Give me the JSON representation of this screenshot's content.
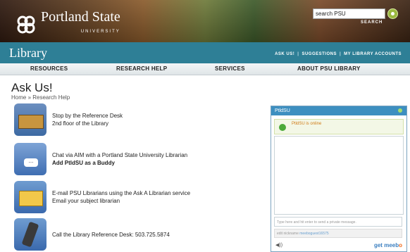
{
  "header": {
    "brand": "Portland State",
    "brand_sub": "UNIVERSITY",
    "search_value": "search PSU",
    "search_label": "SEARCH"
  },
  "library_bar": {
    "title": "Library",
    "links": [
      "ASK US!",
      "SUGGESTIONS",
      "MY LIBRARY ACCOUNTS"
    ]
  },
  "nav": {
    "items": [
      "RESOURCES",
      "RESEARCH HELP",
      "SERVICES",
      "ABOUT PSU LIBRARY"
    ]
  },
  "page": {
    "title": "Ask Us!",
    "breadcrumb": "Home » Research Help"
  },
  "contact_options": [
    {
      "line1": "Stop by the Reference Desk",
      "line2": "2nd floor of the Library",
      "icon": "reference-desk-icon"
    },
    {
      "line1": "Chat via AIM with a Portland State University Librarian",
      "line2": "Add PtldSU as a Buddy",
      "icon": "aim-chat-icon"
    },
    {
      "line1": "E-mail PSU Librarians using the Ask A Librarian service",
      "line2": "Email your subject librarian",
      "icon": "email-envelope-icon"
    },
    {
      "line1": "Call the Library Reference Desk: 503.725.5874",
      "line2": "",
      "icon": "mobile-phone-icon"
    }
  ],
  "chat_widget": {
    "title": "PtldSU",
    "status": "PtldSU is online",
    "input_placeholder": "Type here and hit enter to send a private message.",
    "nick_label": "edit nickname",
    "nick_value": "meeboguest16575",
    "sound": "◀))",
    "brand_get": "get",
    "brand_meebo": "meeb",
    "brand_o": "o"
  }
}
